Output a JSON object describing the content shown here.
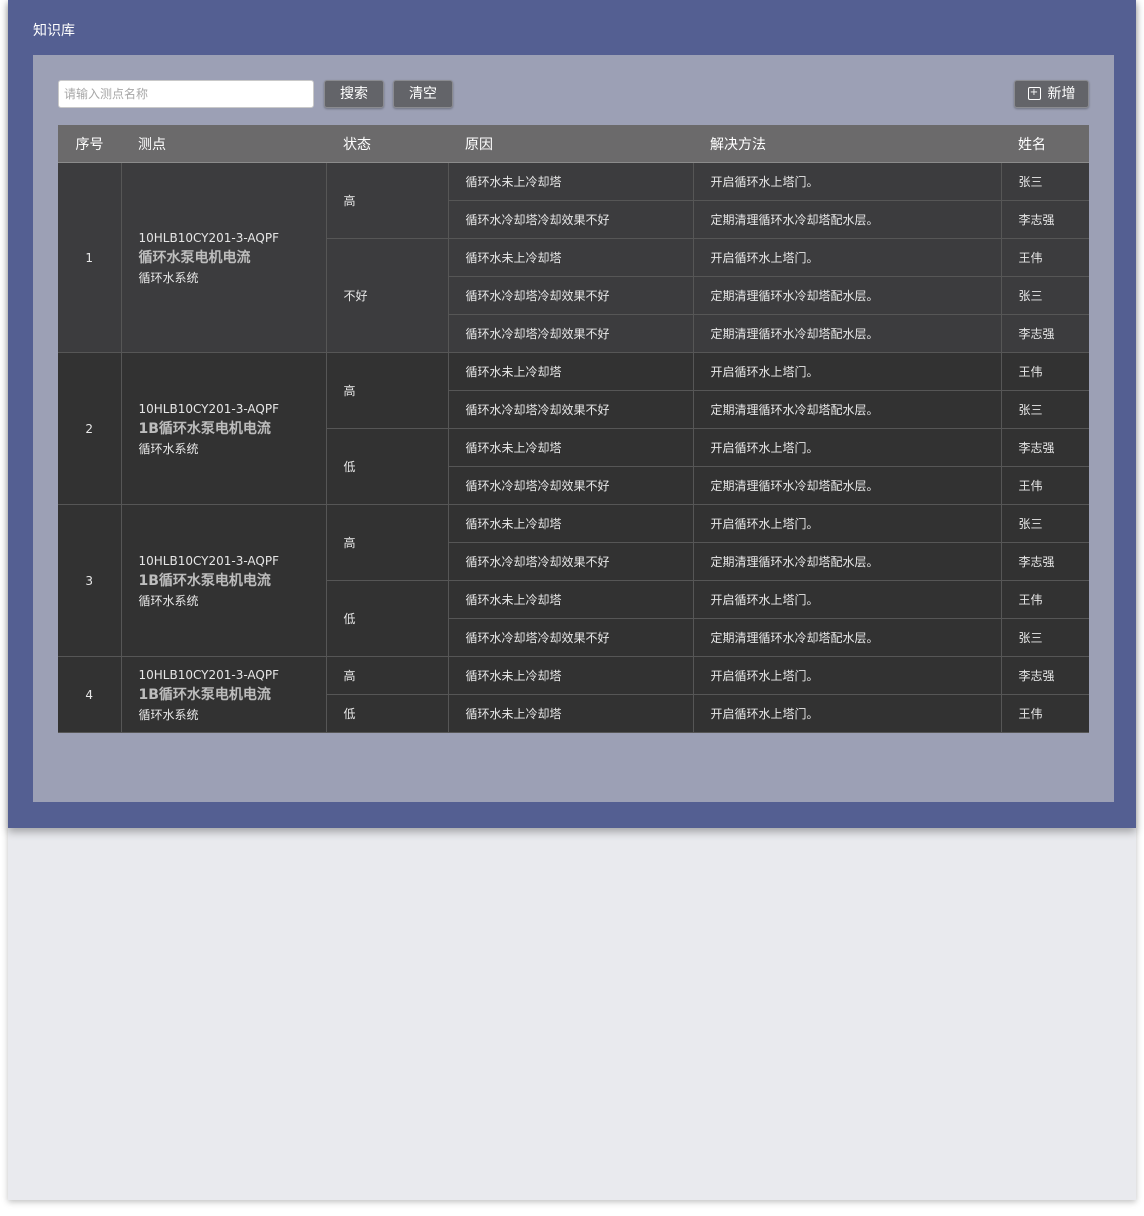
{
  "app": {
    "title": "知识库"
  },
  "toolbar": {
    "search_placeholder": "请输入测点名称",
    "search_label": "搜索",
    "clear_label": "清空",
    "add_label": "新增",
    "add_icon": "plus-square-icon"
  },
  "table": {
    "headers": [
      "序号",
      "测点",
      "状态",
      "原因",
      "解决方法",
      "姓名"
    ],
    "groups": [
      {
        "index": "1",
        "point": {
          "code": "10HLB10CY201-3-AQPF",
          "name": "循环水泵电机电流",
          "system": "循环水系统"
        },
        "states": [
          {
            "label": "高",
            "rows": [
              {
                "reason": "循环水未上冷却塔",
                "solution": "开启循环水上塔门。",
                "person": "张三"
              },
              {
                "reason": "循环水冷却塔冷却效果不好",
                "solution": "定期清理循环水冷却塔配水层。",
                "person": "李志强"
              }
            ]
          },
          {
            "label": "不好",
            "rows": [
              {
                "reason": "循环水未上冷却塔",
                "solution": "开启循环水上塔门。",
                "person": "王伟"
              },
              {
                "reason": "循环水冷却塔冷却效果不好",
                "solution": "定期清理循环水冷却塔配水层。",
                "person": "张三"
              },
              {
                "reason": "循环水冷却塔冷却效果不好",
                "solution": "定期清理循环水冷却塔配水层。",
                "person": "李志强"
              }
            ]
          }
        ]
      },
      {
        "index": "2",
        "point": {
          "code": "10HLB10CY201-3-AQPF",
          "name": "1B循环水泵电机电流",
          "system": "循环水系统"
        },
        "states": [
          {
            "label": "高",
            "rows": [
              {
                "reason": "循环水未上冷却塔",
                "solution": "开启循环水上塔门。",
                "person": "王伟"
              },
              {
                "reason": "循环水冷却塔冷却效果不好",
                "solution": "定期清理循环水冷却塔配水层。",
                "person": "张三"
              }
            ]
          },
          {
            "label": "低",
            "rows": [
              {
                "reason": "循环水未上冷却塔",
                "solution": "开启循环水上塔门。",
                "person": "李志强"
              },
              {
                "reason": "循环水冷却塔冷却效果不好",
                "solution": "定期清理循环水冷却塔配水层。",
                "person": "王伟"
              }
            ]
          }
        ]
      },
      {
        "index": "3",
        "point": {
          "code": "10HLB10CY201-3-AQPF",
          "name": "1B循环水泵电机电流",
          "system": "循环水系统"
        },
        "states": [
          {
            "label": "高",
            "rows": [
              {
                "reason": "循环水未上冷却塔",
                "solution": "开启循环水上塔门。",
                "person": "张三"
              },
              {
                "reason": "循环水冷却塔冷却效果不好",
                "solution": "定期清理循环水冷却塔配水层。",
                "person": "李志强"
              }
            ]
          },
          {
            "label": "低",
            "rows": [
              {
                "reason": "循环水未上冷却塔",
                "solution": "开启循环水上塔门。",
                "person": "王伟"
              },
              {
                "reason": "循环水冷却塔冷却效果不好",
                "solution": "定期清理循环水冷却塔配水层。",
                "person": "张三"
              }
            ]
          }
        ]
      },
      {
        "index": "4",
        "point": {
          "code": "10HLB10CY201-3-AQPF",
          "name": "1B循环水泵电机电流",
          "system": "循环水系统"
        },
        "states": [
          {
            "label": "高",
            "rows": [
              {
                "reason": "循环水未上冷却塔",
                "solution": "开启循环水上塔门。",
                "person": "李志强"
              }
            ]
          },
          {
            "label": "低",
            "rows": [
              {
                "reason": "循环水未上冷却塔",
                "solution": "开启循环水上塔门。",
                "person": "王伟"
              }
            ]
          }
        ]
      }
    ]
  }
}
